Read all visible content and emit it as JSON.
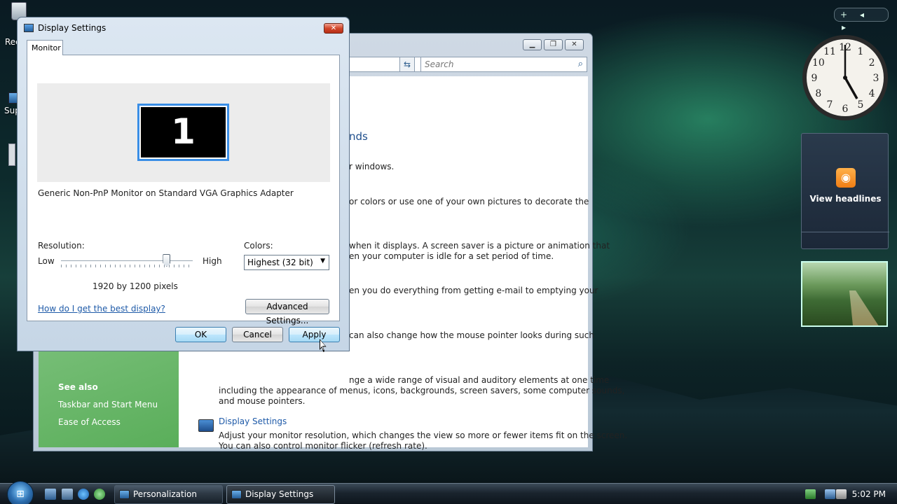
{
  "desktop": {
    "icons": [
      {
        "label": "Rec"
      },
      {
        "label": "Sup"
      }
    ]
  },
  "background_window": {
    "search_placeholder": "Search",
    "heading_fragment": "nds",
    "lines": [
      "r windows.",
      "or colors or use one of your own pictures to decorate the",
      "when it displays. A screen saver is a picture or animation that",
      "en your computer is idle for a set period of time.",
      "en you do everything from getting e-mail to emptying your",
      "can also change how the mouse pointer looks during such",
      "nge a wide range of visual and auditory elements at one time",
      "including the appearance of menus, icons, backgrounds, screen savers, some computer sounds,",
      "and mouse pointers."
    ],
    "display_settings_link": "Display Settings",
    "display_settings_desc": [
      "Adjust your monitor resolution, which changes the view so more or fewer items fit on the screen.",
      "You can also control monitor flicker (refresh rate)."
    ],
    "see_also": {
      "title": "See also",
      "links": [
        "Taskbar and Start Menu",
        "Ease of Access"
      ]
    }
  },
  "dialog": {
    "title": "Display Settings",
    "close_glyph": "✕",
    "tab": "Monitor",
    "monitor_number": "1",
    "monitor_desc": "Generic Non-PnP Monitor on Standard VGA Graphics Adapter",
    "resolution": {
      "label": "Resolution:",
      "low": "Low",
      "high": "High",
      "value_text": "1920 by 1200 pixels",
      "slider_fraction": 0.8
    },
    "colors": {
      "label": "Colors:",
      "selected": "Highest (32 bit)"
    },
    "help_link": "How do I get the best display?",
    "advanced_button": "Advanced Settings...",
    "ok": "OK",
    "cancel": "Cancel",
    "apply": "Apply"
  },
  "gadgets": {
    "bar": [
      "+",
      "◂",
      "▸"
    ],
    "feed_label": "View headlines",
    "clock_numbers": [
      "12",
      "1",
      "2",
      "3",
      "4",
      "5",
      "6",
      "7",
      "8",
      "9",
      "10",
      "11"
    ]
  },
  "taskbar": {
    "start_glyph": "⊞",
    "buttons": [
      {
        "label": "Personalization"
      },
      {
        "label": "Display Settings"
      }
    ],
    "time": "5:02 PM"
  }
}
